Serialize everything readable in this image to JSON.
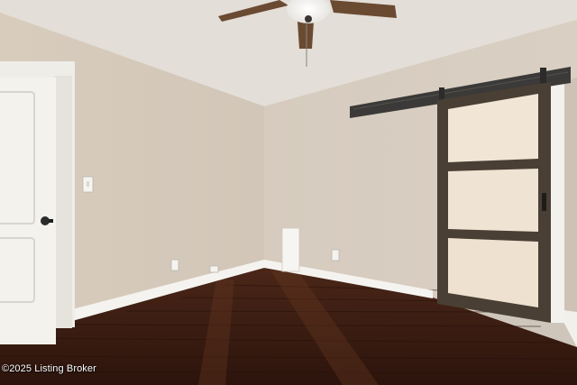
{
  "photo": {
    "watermark": "©2025 Listing Broker"
  },
  "colors": {
    "ceiling": "#e2ddd6",
    "left_wall": "#d9cdbf",
    "back_wall": "#d7ccbf",
    "right_wall": "#cfc4b7",
    "floor": "#3a1d12",
    "baseboard": "#f5f3ef",
    "door_white": "#f3f1ec",
    "barn_frame": "#4a3f35",
    "barn_panel": "#f0e3d3",
    "barn_rail": "#3b3a38",
    "fan_blade": "#6b4a32"
  }
}
